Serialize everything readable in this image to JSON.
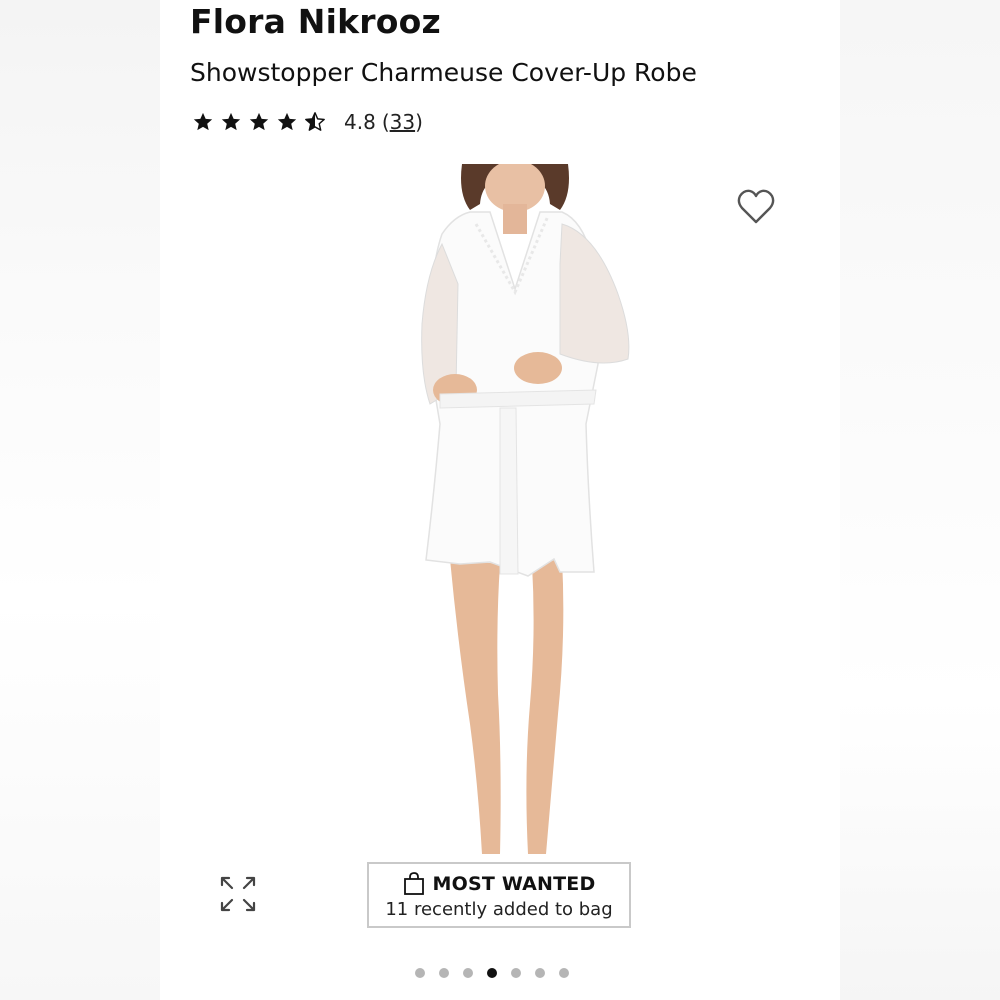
{
  "product": {
    "brand": "Flora Nikrooz",
    "name": "Showstopper Charmeuse Cover-Up Robe"
  },
  "rating": {
    "value": "4.8",
    "count_open": "(",
    "count": "33",
    "count_close": ")",
    "stars": 4.5,
    "max_stars": 5
  },
  "badge": {
    "icon": "shopping-bag-icon",
    "title": "MOST WANTED",
    "subtitle": "11 recently added to bag"
  },
  "gallery": {
    "total_images": 7,
    "active_index": 3
  },
  "icons": {
    "wishlist": "heart-outline-icon",
    "expand": "expand-arrows-icon"
  },
  "colors": {
    "text": "#111111",
    "dot_inactive": "#b5b5b5",
    "dot_active": "#111111",
    "badge_border": "#c9c9c9"
  }
}
